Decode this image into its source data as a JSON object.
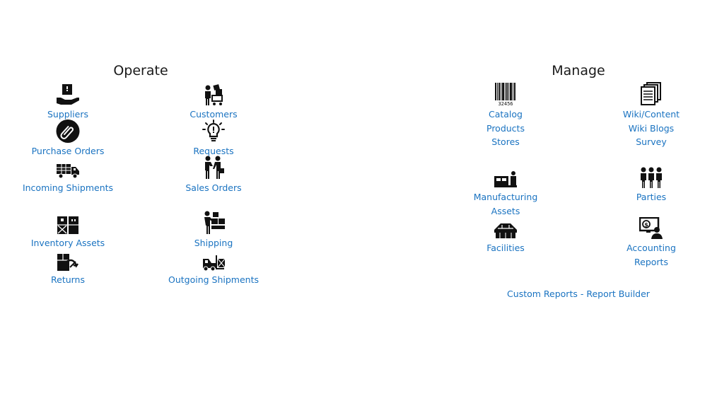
{
  "operate": {
    "title": "Operate",
    "items": [
      {
        "icon": "supplier-icon",
        "links": [
          "Suppliers"
        ]
      },
      {
        "icon": "customers-icon",
        "links": [
          "Customers"
        ]
      },
      {
        "icon": "paperclip-icon",
        "links": [
          "Purchase Orders"
        ]
      },
      {
        "icon": "lightbulb-icon",
        "links": [
          "Requests"
        ]
      },
      {
        "icon": "truck-icon",
        "links": [
          "Incoming Shipments"
        ]
      },
      {
        "icon": "handshake-icon",
        "links": [
          "Sales Orders"
        ]
      },
      {
        "icon": "inventory-boxes-icon",
        "links": [
          "Inventory Assets"
        ]
      },
      {
        "icon": "shipping-worker-icon",
        "links": [
          "Shipping"
        ]
      },
      {
        "icon": "returns-icon",
        "links": [
          "Returns"
        ]
      },
      {
        "icon": "forklift-icon",
        "links": [
          "Outgoing Shipments"
        ]
      }
    ]
  },
  "manage": {
    "title": "Manage",
    "items": [
      {
        "icon": "barcode-icon",
        "links": [
          "Catalog",
          "Products",
          "Stores"
        ]
      },
      {
        "icon": "documents-icon",
        "links": [
          "Wiki/Content",
          "Wiki Blogs",
          "Survey"
        ]
      },
      {
        "icon": "factory-machine-icon",
        "links": [
          "Manufacturing",
          "Assets"
        ]
      },
      {
        "icon": "people-group-icon",
        "links": [
          "Parties"
        ]
      },
      {
        "icon": "warehouse-icon",
        "links": [
          "Facilities"
        ]
      },
      {
        "icon": "accounting-icon",
        "links": [
          "Accounting",
          "Reports"
        ]
      }
    ],
    "barcode_number": "32456",
    "custom_reports": "Custom Reports - Report Builder"
  }
}
